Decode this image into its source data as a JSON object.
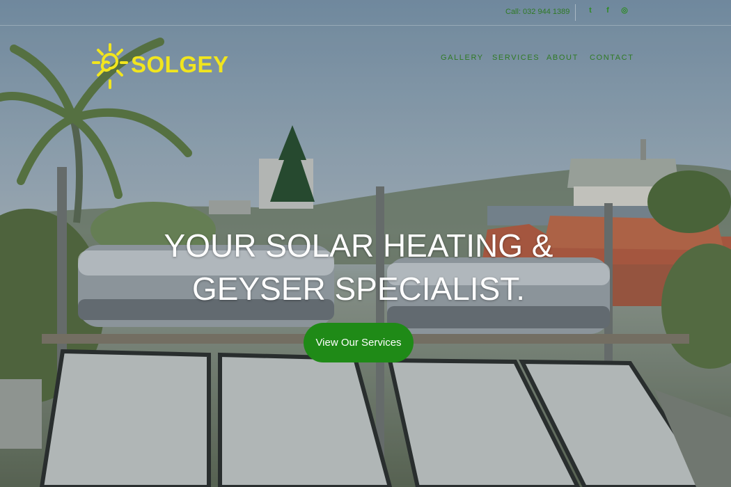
{
  "topbar": {
    "call_text": "Call: 032 944 1389",
    "social": [
      {
        "name": "twitter-icon",
        "glyph": "t"
      },
      {
        "name": "facebook-icon",
        "glyph": "f"
      },
      {
        "name": "instagram-icon",
        "glyph": "◎"
      }
    ]
  },
  "brand": {
    "name": "SOLGEY",
    "logo_color": "#f1e51e"
  },
  "nav": {
    "items": [
      "GALLERY",
      "SERVICES",
      "ABOUT",
      "CONTACT"
    ],
    "color": "#2f7a24"
  },
  "hero": {
    "line1": "YOUR SOLAR HEATING &",
    "line2": "GEYSER SPECIALIST.",
    "cta_label": "View Our Services",
    "cta_color": "#1f8a17"
  }
}
